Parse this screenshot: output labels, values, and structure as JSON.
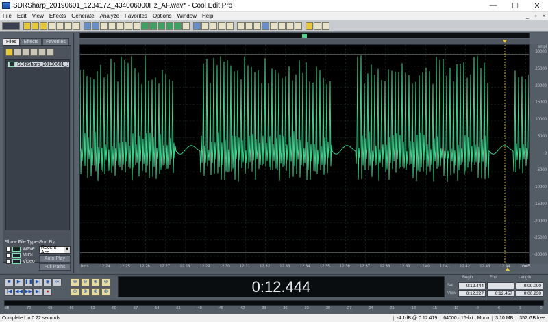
{
  "window": {
    "title": "SDRSharp_20190601_123417Z_434006000Hz_AF.wav* - Cool Edit Pro",
    "minimize": "—",
    "maximize": "☐",
    "close": "✕"
  },
  "menu": {
    "items": [
      "File",
      "Edit",
      "View",
      "Effects",
      "Generate",
      "Analyze",
      "Favorites",
      "Options",
      "Window",
      "Help"
    ],
    "right_controls": [
      "_",
      "▫",
      "×"
    ]
  },
  "panel": {
    "tabs": [
      "Files",
      "Effects",
      "Favorites"
    ],
    "active_tab": "Files",
    "file_item": "SDRSharp_20190601_123...",
    "show_file_types_label": "Show File Types:",
    "sort_by_label": "Sort By:",
    "types": [
      "Wave",
      "MIDI",
      "Video"
    ],
    "sort_value": "Recent Acc",
    "auto_play": "Auto Play",
    "full_paths": "Full Paths"
  },
  "waveform": {
    "amplitude_unit": "smpl",
    "amplitude_labels": [
      "30000",
      "25000",
      "20000",
      "15000",
      "10000",
      "5000",
      "0",
      "-5000",
      "-10000",
      "-15000",
      "-20000",
      "-25000",
      "-30000"
    ],
    "time_unit": "hms",
    "time_labels": [
      "12.24",
      "12.25",
      "12.26",
      "12.27",
      "12.28",
      "12.29",
      "12.30",
      "12.31",
      "12.32",
      "12.33",
      "12.34",
      "12.35",
      "12.36",
      "12.37",
      "12.38",
      "12.39",
      "12.40",
      "12.41",
      "12.42",
      "12.43",
      "12.44",
      "12.45"
    ],
    "colors": {
      "wave": "#3fd08d",
      "background": "#000000",
      "grid": "#1f3b2c",
      "marker": "#e6c93a"
    }
  },
  "transport": {
    "time_display": "0:12.444",
    "headers": {
      "begin": "Begin",
      "end": "End",
      "length": "Length"
    },
    "sel_label": "Sel",
    "view_label": "View",
    "sel": {
      "begin": "0:12.444",
      "end": "",
      "length": "0:00.000"
    },
    "view": {
      "begin": "0:12.227",
      "end": "0:12.457",
      "length": "0:00.230"
    }
  },
  "level_meter": {
    "labels": [
      "dB",
      "-72",
      "-69",
      "-66",
      "-63",
      "-60",
      "-57",
      "-54",
      "-51",
      "-48",
      "-45",
      "-42",
      "-39",
      "-36",
      "-33",
      "-30",
      "-27",
      "-24",
      "-21",
      "-18",
      "-15",
      "-12",
      "-9",
      "-6",
      "-3",
      "0"
    ]
  },
  "status": {
    "message": "Completed in 0.22 seconds",
    "level": "-4.1dB @ 0:12.419",
    "format": "64000 · 16-bit · Mono",
    "size": "3.10 MB",
    "free": "352 GB free"
  }
}
